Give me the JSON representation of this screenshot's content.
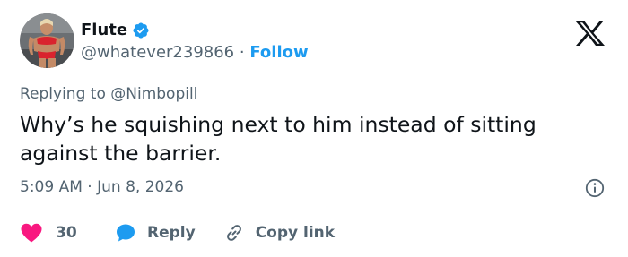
{
  "author": {
    "display_name": "Flute",
    "handle": "@whatever239866",
    "separator": "·",
    "follow_label": "Follow"
  },
  "reply_context": {
    "prefix": "Replying to",
    "mention": "@Nimbopill"
  },
  "tweet": {
    "text": "Why’s he squishing next to him instead of sitting against the barrier.",
    "time": "5:09 AM",
    "separator": "·",
    "date": "Jun 8, 2026"
  },
  "actions": {
    "like_count": "30",
    "reply_label": "Reply",
    "copy_link_label": "Copy link"
  },
  "icons": {
    "brand": "x-logo-icon",
    "verified": "verified-badge-icon",
    "info": "info-icon",
    "like": "heart-icon",
    "reply": "speech-bubble-icon",
    "copy": "link-icon"
  },
  "colors": {
    "accent": "#1d9bf0",
    "like": "#f91880",
    "text": "#0f1419",
    "muted": "#536471",
    "divider": "#cfd9de"
  }
}
